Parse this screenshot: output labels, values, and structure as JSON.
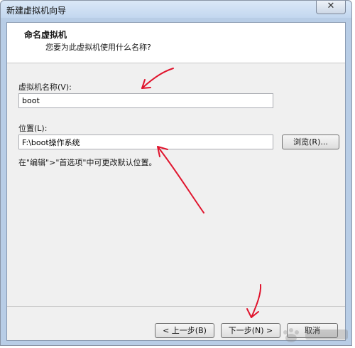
{
  "window": {
    "title": "新建虚拟机向导",
    "close_glyph": "✕"
  },
  "header": {
    "title": "命名虚拟机",
    "subtitle": "您要为此虚拟机使用什么名称?"
  },
  "form": {
    "name_label": "虚拟机名称(V):",
    "name_value": "boot",
    "location_label": "位置(L):",
    "location_value": "F:\\boot操作系统",
    "browse_label": "浏览(R)...",
    "hint": "在\"编辑\">\"首选项\"中可更改默认位置。"
  },
  "footer": {
    "back_label": "< 上一步(B)",
    "next_label": "下一步(N) >",
    "cancel_label": "取消"
  },
  "colors": {
    "annotation": "#e0142d",
    "window_frame": "#b8cde6"
  }
}
